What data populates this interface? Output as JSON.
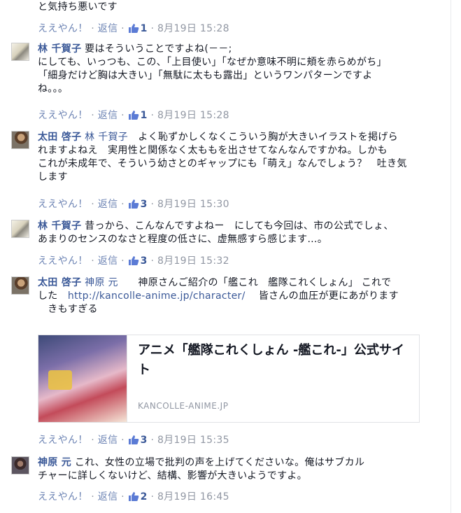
{
  "labels": {
    "like": "ええやん！",
    "reply": "返信",
    "sep": " · "
  },
  "top_fragment": {
    "text": "と気持ち悪いです",
    "likes": "1",
    "time": "8月19日 15:28"
  },
  "comments": [
    {
      "author": "林 千賀子",
      "tag": "",
      "lines": [
        "要はそういうことですよね(－－;",
        "にしても、いっつも、この、「上目使い」「なぜか意味不明に頬を赤らめがち」",
        "「細身だけど胸は大きい」「無駄に太もも露出」というワンパターンですよ",
        "ね。。。"
      ],
      "likes": "1",
      "time": "8月19日 15:28"
    },
    {
      "author": "太田 啓子",
      "tag": "林 千賀子",
      "lines": [
        "よく恥ずかしくなくこういう胸が大きいイラストを掲げら",
        "れますよねえ　実用性と関係なく太ももを出させてなんなんですかね。しかも",
        "これが未成年で、そういう幼さとのギャップにも「萌え」なんでしょう？　吐き気",
        "します"
      ],
      "likes": "3",
      "time": "8月19日 15:30"
    },
    {
      "author": "林 千賀子",
      "tag": "",
      "lines": [
        "昔っから、こんなんですよねー　にしても今回は、市の公式でしょ、",
        "あまりのセンスのなさと程度の低さに、虚無感すら感じます…。"
      ],
      "likes": "3",
      "time": "8月19日 15:32"
    },
    {
      "author": "太田 啓子",
      "tag": "神原 元",
      "lines": [
        "　神原さんご紹介の「艦これ　艦隊これくしょん」 これで",
        "した",
        "皆さんの血圧が更にあがります",
        "　きもすぎる"
      ],
      "link": "http://kancolle-anime.jp/character/",
      "likes": "3",
      "time": "8月19日 15:35",
      "preview": {
        "title": "アニメ「艦隊これくしょん -艦これ-」公式サイト",
        "domain": "KANCOLLE-ANIME.JP"
      }
    },
    {
      "author": "神原 元",
      "tag": "",
      "lines": [
        "これ、女性の立場で批判の声を上げてくださいな。俺はサブカル",
        "チャーに詳しくないけど、結構、影響が大きいようですよ。"
      ],
      "likes": "2",
      "time": "8月19日 16:45"
    }
  ]
}
